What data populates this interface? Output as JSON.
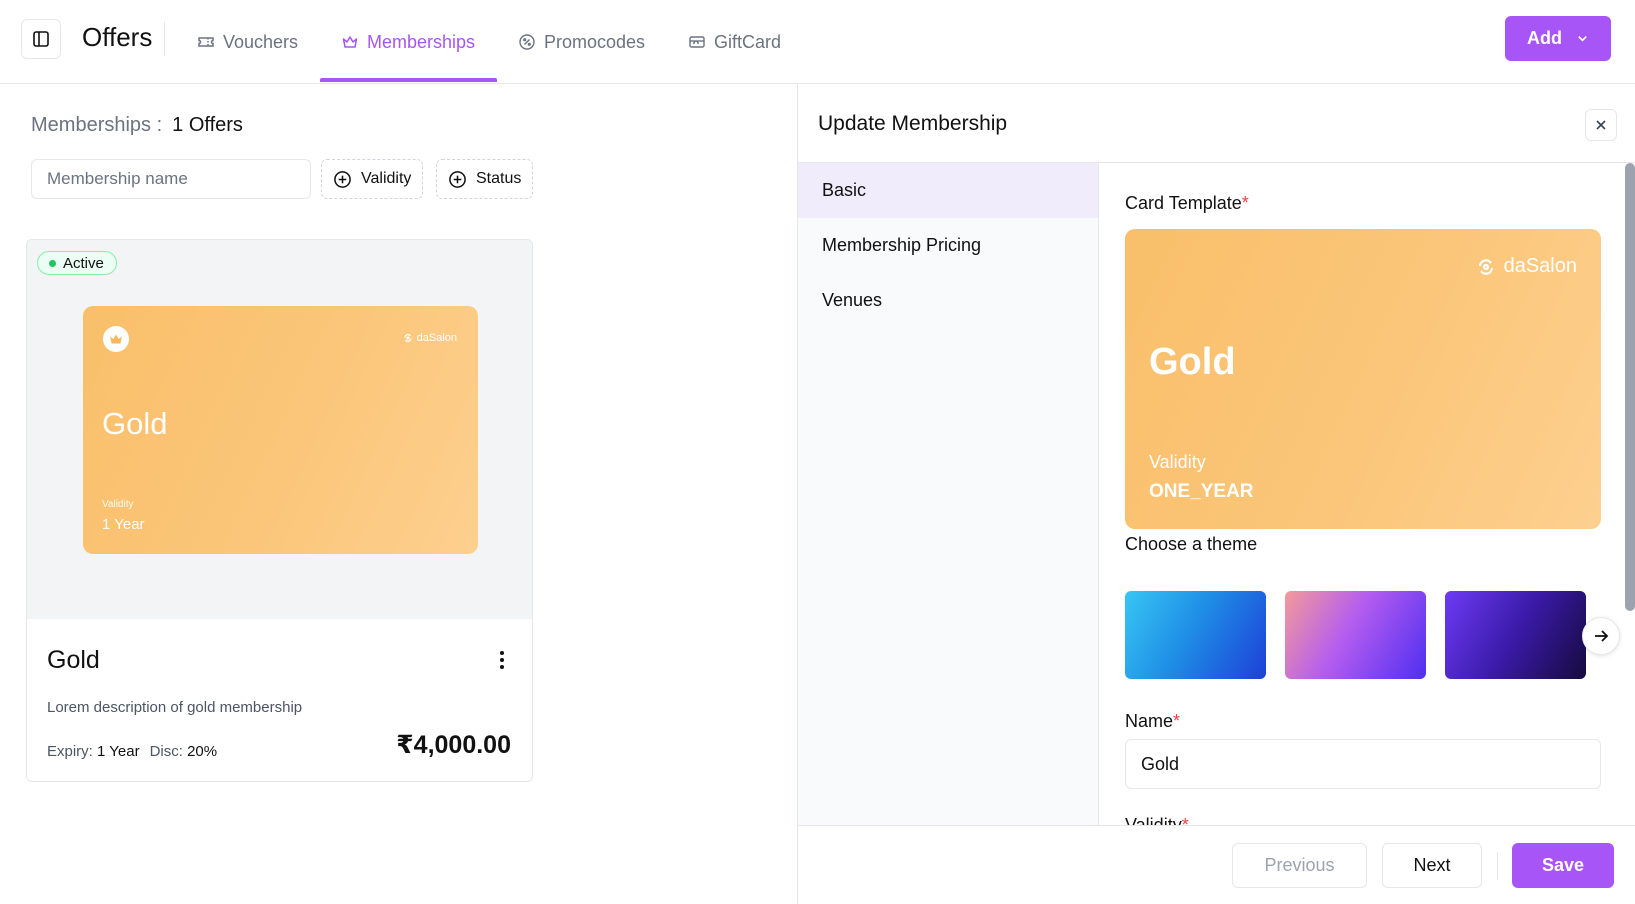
{
  "header": {
    "title": "Offers",
    "tabs": [
      {
        "label": "Vouchers",
        "icon": "ticket-icon",
        "active": false
      },
      {
        "label": "Memberships",
        "icon": "crown-icon",
        "active": true
      },
      {
        "label": "Promocodes",
        "icon": "discount-badge-icon",
        "active": false
      },
      {
        "label": "GiftCard",
        "icon": "gift-card-icon",
        "active": false
      }
    ],
    "add_label": "Add",
    "accent_color": "#a855f7"
  },
  "list": {
    "heading_label": "Memberships :",
    "heading_count": "1 Offers",
    "search_placeholder": "Membership name",
    "filters": [
      {
        "label": "Validity"
      },
      {
        "label": "Status"
      }
    ],
    "cards": [
      {
        "status": "Active",
        "preview": {
          "brand": "daSalon",
          "name": "Gold",
          "validity_label": "Validity",
          "validity_value": "1 Year"
        },
        "name": "Gold",
        "description": "Lorem description of gold membership",
        "expiry_label": "Expiry:",
        "expiry_value": "1 Year",
        "disc_label": "Disc:",
        "disc_value": "20%",
        "price": "₹4,000.00"
      }
    ]
  },
  "panel": {
    "title": "Update Membership",
    "nav": [
      {
        "label": "Basic",
        "active": true
      },
      {
        "label": "Membership Pricing",
        "active": false
      },
      {
        "label": "Venues",
        "active": false
      }
    ],
    "card_template_label": "Card Template",
    "template": {
      "brand": "daSalon",
      "name": "Gold",
      "validity_label": "Validity",
      "validity_value": "ONE_YEAR",
      "colors": [
        "#f9bf6a",
        "#fdd08f"
      ]
    },
    "theme_label": "Choose a theme",
    "themes": [
      {
        "colors": [
          "#38c6f4",
          "#1d4ed8"
        ]
      },
      {
        "colors": [
          "#f49a9a",
          "#a855f7",
          "#4f2ef0"
        ]
      },
      {
        "colors": [
          "#6d3bf5",
          "#160a3d"
        ]
      }
    ],
    "name_label": "Name",
    "name_value": "Gold",
    "validity_label": "Validity",
    "required_mark": "*",
    "footer": {
      "previous_label": "Previous",
      "next_label": "Next",
      "save_label": "Save"
    }
  }
}
